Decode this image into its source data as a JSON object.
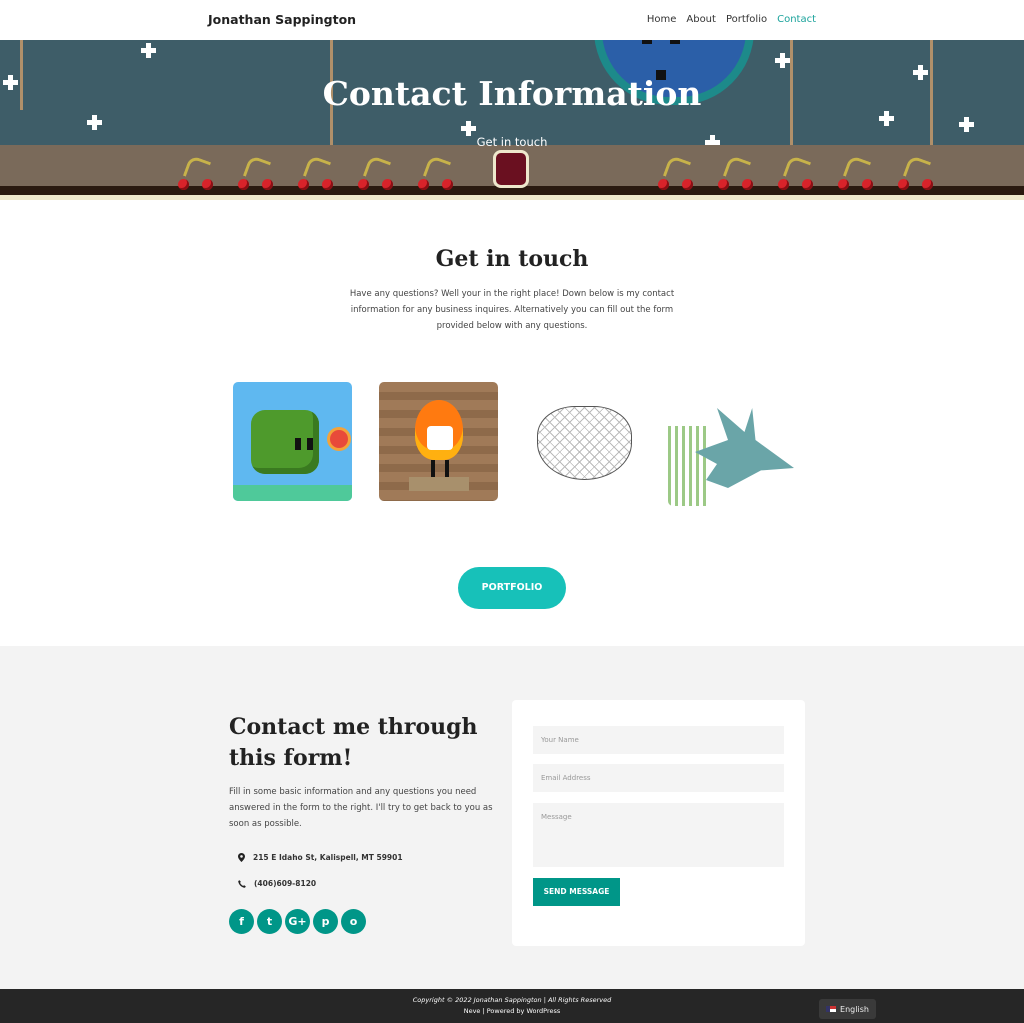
{
  "header": {
    "site_title": "Jonathan Sappington",
    "nav": [
      "Home",
      "About",
      "Portfolio",
      "Contact"
    ],
    "active": "Contact"
  },
  "hero": {
    "title": "Contact Information",
    "subtitle": "Get in touch"
  },
  "intro": {
    "title": "Get in touch",
    "text": "Have any questions? Well your in the right place! Down below is my contact information for any business inquires. Alternatively you can fill out the form provided below with any questions."
  },
  "portfolio_button": "PORTFOLIO",
  "contact": {
    "title": "Contact me through this form!",
    "text": "Fill in some basic information and any questions you need answered in the form to the right. I'll try to get back to you as soon as possible.",
    "address": "215 E Idaho St, Kalispell, MT 59901",
    "phone": "(406)609-8120",
    "social": [
      "f",
      "t",
      "G+",
      "p",
      "o"
    ]
  },
  "form": {
    "name_placeholder": "Your Name",
    "email_placeholder": "Email Address",
    "message_placeholder": "Message",
    "send_label": "SEND MESSAGE"
  },
  "footer": {
    "copyright": "Copyright © 2022 Jonathan Sappington | All Rights Reserved",
    "powered": "Neve | Powered by WordPress",
    "language": "English"
  },
  "colors": {
    "accent": "#1ba39c",
    "button": "#17c1b9",
    "form_button": "#009688"
  }
}
